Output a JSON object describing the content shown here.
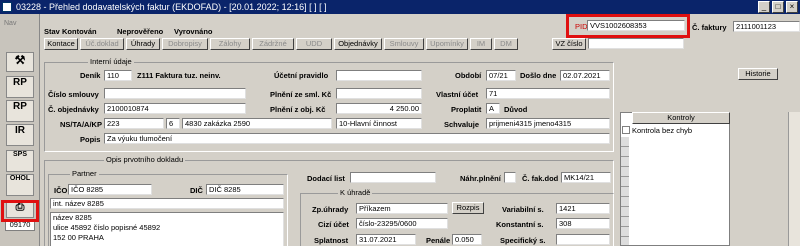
{
  "window": {
    "title": "03228 - Přehled dodavatelských faktur (EKDOFAD) - [20.01.2022; 12:16] [ ] [ ]"
  },
  "header": {
    "stav_label": "Stav",
    "stav_value": "Kontován",
    "state2": "Neprověřeno",
    "state3": "Vyrovnáno",
    "pid_label": "PID",
    "pid_value": "VVS1002608353",
    "cfaktury_label": "Č. faktury",
    "cfaktury_value": "2111001123",
    "vz_label": "VZ číslo",
    "vz_value": ""
  },
  "tabs": [
    "Kontace",
    "Úč.doklad",
    "Úhrady",
    "Dobropisy",
    "Zálohy",
    "Zádržné",
    "UDD",
    "Objednávky",
    "Smlouvy",
    "Upomínky",
    "IM",
    "DM"
  ],
  "sidebar": {
    "nav": "Nav",
    "rp1": "RP",
    "rp2": "RP",
    "ir": "IR",
    "sps": "SPS",
    "ohol": "OHOL",
    "badge": "09170"
  },
  "interni": {
    "title": "Interní údaje",
    "denik_label": "Deník",
    "denik_value": "110",
    "denik_desc": "Z111 Faktura tuz. neinv.",
    "ucetni_label": "Účetní pravidlo",
    "ucetni_value": "",
    "obdobi_label": "Období",
    "obdobi_value": "07/21",
    "doslo_label": "Došlo dne",
    "doslo_value": "02.07.2021",
    "historie": "Historie",
    "smlouvy_label": "Číslo smlouvy",
    "smlouvy_value": "",
    "plneni_sml_label": "Plnění ze sml. Kč",
    "plneni_sml_value": "",
    "vlastni_label": "Vlastní účet",
    "vlastni_value": "71",
    "objednavky_label": "Č. objednávky",
    "objednavky_value": "2100010874",
    "plneni_obj_label": "Plnění z obj. Kč",
    "plneni_obj_value": "4 250.00",
    "proplatit_label": "Proplatit",
    "proplatit_value": "A",
    "duvod_label": "Důvod",
    "ns_label": "NS/TA/A/KP",
    "ns_v1": "223",
    "ns_v2": "6",
    "ns_v3": "4830 zakázka 2590",
    "ns_v4": "10-Hlavní činnost",
    "schvaluje_label": "Schvaluje",
    "schvaluje_value": "prijmeni4315 jmeno4315",
    "popis_label": "Popis",
    "popis_value": "Za výuku tlumočení"
  },
  "kontroly": {
    "title": "Kontroly",
    "items": [
      "Kontrola bez chyb"
    ]
  },
  "opis": {
    "title": "Opis prvotního dokladu",
    "partner_title": "Partner",
    "ico_label": "IČO",
    "ico_value": "IČO 8285",
    "dic_label": "DIČ",
    "dic_value": "DIČ 8285",
    "int_nazev": "int. název 8285",
    "address": [
      "název 8285",
      "ulice 45892 číslo popisné 45892",
      "152 00 PRAHA"
    ],
    "dodaci_label": "Dodací list",
    "dodaci_value": "",
    "nahr_label": "Náhr.plnění",
    "cfakdod_label": "Č. fak.dod",
    "cfakdod_value": "MK14/21"
  },
  "uhrade": {
    "title": "K úhradě",
    "zp_label": "Zp.úhrady",
    "zp_value": "Příkazem",
    "rozpis": "Rozpis",
    "variabilni_label": "Variabilní s.",
    "variabilni_value": "1421",
    "cizi_label": "Cizí účet",
    "cizi_value": "číslo-23295/0600",
    "konstantni_label": "Konstantní s.",
    "konstantni_value": "308",
    "splatnost_label": "Splatnost",
    "splatnost_value": "31.07.2021",
    "penale_label": "Penále",
    "penale_value": "0.050",
    "specificky_label": "Specifický s.",
    "specificky_value": ""
  }
}
